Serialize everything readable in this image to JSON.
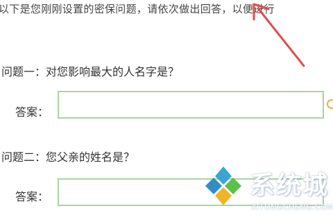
{
  "intro_text": "以下是您刚刚设置的密保问题，请依次做出回答，以便进行",
  "questions": [
    {
      "question": "问题一：对您影响最大的人名字是？",
      "answer_label": "答案：",
      "answer_value": ""
    },
    {
      "question": "问题二：您父亲的姓名是？",
      "answer_label": "答案：",
      "answer_value": ""
    }
  ],
  "watermark": {
    "title": "系统城",
    "subtitle": "XITONGCHENG.COM"
  },
  "colors": {
    "input_border": "#a9d4a0",
    "annotation_arrow": "#e04a4a",
    "hint_icon": "#e8b04a"
  }
}
